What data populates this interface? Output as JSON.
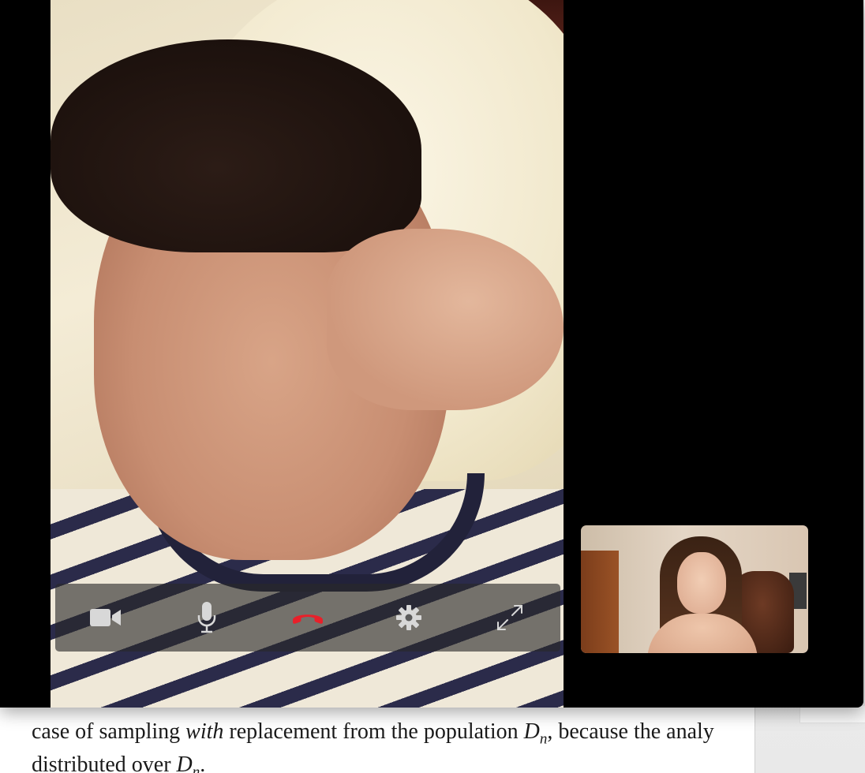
{
  "document": {
    "line1": {
      "a": "case of sampling ",
      "b": "with",
      "c": " replacement from the population ",
      "d": "D",
      "e": "n",
      "f": ", because the analy"
    },
    "line2": {
      "a": "distributed over ",
      "b": "D",
      "c": "n",
      "d": "."
    }
  },
  "call": {
    "controls": {
      "video_icon": "video-camera-icon",
      "mic_icon": "microphone-icon",
      "end_icon": "end-call-icon",
      "settings_icon": "gear-icon",
      "fullscreen_icon": "fullscreen-icon"
    },
    "colors": {
      "end_call": "#e8202a",
      "icon": "#d8d8d8"
    }
  }
}
